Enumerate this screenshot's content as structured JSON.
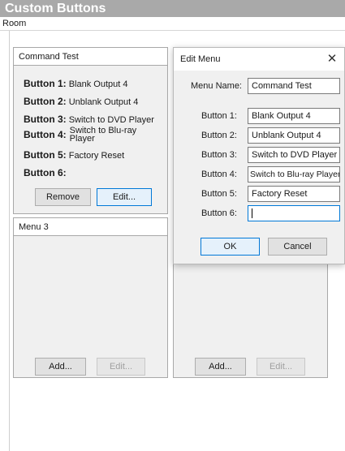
{
  "window": {
    "title": "Custom Buttons"
  },
  "room_bar": {
    "label": "Room"
  },
  "command_panel": {
    "title": "Command Test",
    "buttons": [
      {
        "label": "Button 1:",
        "value": "Blank Output 4"
      },
      {
        "label": "Button 2:",
        "value": "Unblank Output 4"
      },
      {
        "label": "Button 3:",
        "value": "Switch to DVD Player"
      },
      {
        "label": "Button 4:",
        "value_line1": "Switch to Blu-ray",
        "value_line2": "Player"
      },
      {
        "label": "Button 5:",
        "value": "Factory Reset"
      },
      {
        "label": "Button 6:",
        "value": ""
      }
    ],
    "remove_label": "Remove",
    "edit_label": "Edit..."
  },
  "menu3_panel": {
    "title": "Menu 3",
    "add_label": "Add...",
    "edit_label": "Edit..."
  },
  "right_panel": {
    "add_label": "Add...",
    "edit_label": "Edit..."
  },
  "edit_dialog": {
    "title": "Edit Menu",
    "close_glyph": "✕",
    "menu_name_label": "Menu Name:",
    "menu_name_value": "Command Test",
    "fields": [
      {
        "label": "Button 1:",
        "value": "Blank Output 4"
      },
      {
        "label": "Button 2:",
        "value": "Unblank Output 4"
      },
      {
        "label": "Button 3:",
        "value": "Switch to DVD Player"
      },
      {
        "label": "Button 4:",
        "value": "Switch to Blu-ray Player"
      },
      {
        "label": "Button 5:",
        "value": "Factory Reset"
      },
      {
        "label": "Button 6:",
        "value": ""
      }
    ],
    "ok_label": "OK",
    "cancel_label": "Cancel"
  },
  "colors": {
    "title_bar": "#a9a9a9",
    "panel_bg": "#f0f0f0",
    "focus_blue": "#0078d7"
  }
}
